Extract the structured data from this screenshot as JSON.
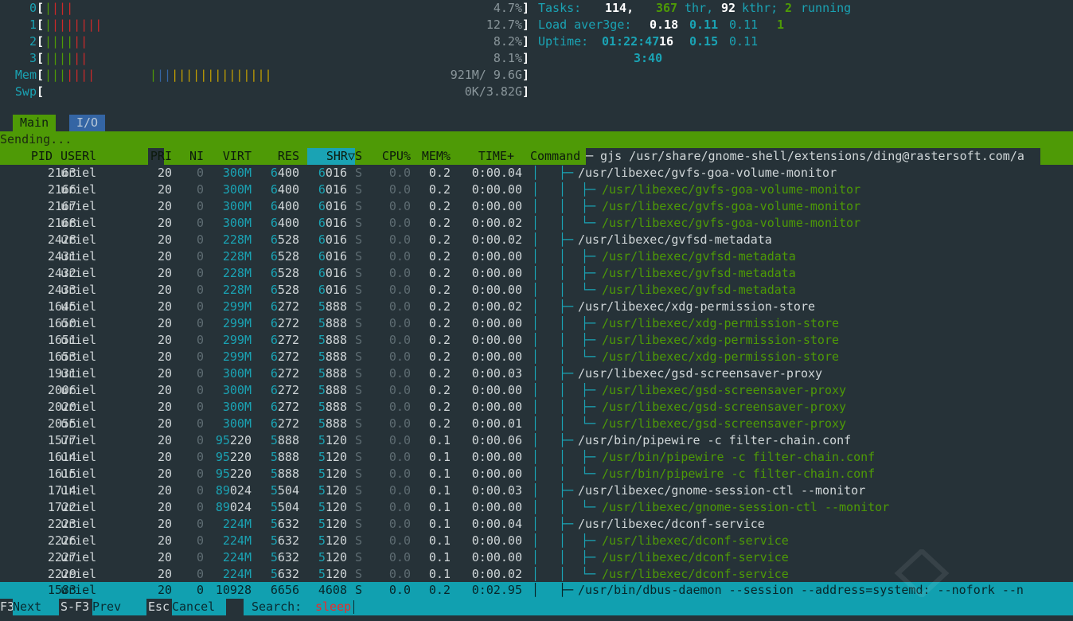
{
  "meters": {
    "cpus": [
      {
        "label": "0",
        "percent": "4.7%",
        "bars_green": 1,
        "bars_red": 3
      },
      {
        "label": "1",
        "percent": "12.7%",
        "bars_green": 1,
        "bars_red": 7
      },
      {
        "label": "2",
        "percent": "8.2%",
        "bars_green": 4,
        "bars_red": 2
      },
      {
        "label": "3",
        "percent": "8.1%",
        "bars_green": 4,
        "bars_red": 2
      }
    ],
    "mem": {
      "label": "Mem",
      "value": "921M/ 9.6G"
    },
    "swp": {
      "label": "Swp",
      "value": "0K/3.82G"
    }
  },
  "summary": {
    "tasks_label": "Tasks:",
    "tasks": "114,",
    "threads": "367",
    "thr_label": "thr,",
    "kthreads": "92",
    "kthr_label": "kthr;",
    "running": "2",
    "running_label": "running",
    "load_label": "Load aver3ge:",
    "load1": "0.18",
    "load5": "0.11",
    "load15": "0.11",
    "load_extra": "1",
    "uptime_label": "Uptime:",
    "uptime": "01:22:47",
    "uptime_bold": "16",
    "uptime_a": "0.15",
    "uptime_b": "0.11",
    "uptime_wrap": "3:40"
  },
  "tabs": {
    "main": "Main",
    "io": "I/O"
  },
  "status_text": "Sending...",
  "columns": {
    "pid": "PID",
    "user": "USERl",
    "pri": "PRI",
    "ni": "NI",
    "virt": "VIRT",
    "res": "RES",
    "shr": "SHR",
    "sort_arrow": "▽",
    "s": "S",
    "cpu": "CPU%",
    "mem": "MEM%",
    "time": "TIME+",
    "command": "Command"
  },
  "header_cmd": "─ gjs /usr/share/gnome-shell/extensions/ding@rastersoft.com/a",
  "processes": [
    {
      "pid": "2163",
      "user": "uriel",
      "pri": "20",
      "ni": "0",
      "virt": "300M",
      "res_a": "6",
      "res_b": "400",
      "shr_a": "6",
      "shr_b": "016",
      "s": "S",
      "cpu": "0.0",
      "mem": "0.2",
      "time": "0:00.04",
      "tree": "├─",
      "cmd": "/usr/libexec/gvfs-goa-volume-monitor",
      "child": false
    },
    {
      "pid": "2166",
      "user": "uriel",
      "pri": "20",
      "ni": "0",
      "virt": "300M",
      "res_a": "6",
      "res_b": "400",
      "shr_a": "6",
      "shr_b": "016",
      "s": "S",
      "cpu": "0.0",
      "mem": "0.2",
      "time": "0:00.00",
      "tree": "├─",
      "cmd": "/usr/libexec/gvfs-goa-volume-monitor",
      "child": true
    },
    {
      "pid": "2167",
      "user": "uriel",
      "pri": "20",
      "ni": "0",
      "virt": "300M",
      "res_a": "6",
      "res_b": "400",
      "shr_a": "6",
      "shr_b": "016",
      "s": "S",
      "cpu": "0.0",
      "mem": "0.2",
      "time": "0:00.00",
      "tree": "├─",
      "cmd": "/usr/libexec/gvfs-goa-volume-monitor",
      "child": true
    },
    {
      "pid": "2168",
      "user": "uriel",
      "pri": "20",
      "ni": "0",
      "virt": "300M",
      "res_a": "6",
      "res_b": "400",
      "shr_a": "6",
      "shr_b": "016",
      "s": "S",
      "cpu": "0.0",
      "mem": "0.2",
      "time": "0:00.02",
      "tree": "└─",
      "cmd": "/usr/libexec/gvfs-goa-volume-monitor",
      "child": true
    },
    {
      "pid": "2428",
      "user": "uriel",
      "pri": "20",
      "ni": "0",
      "virt": "228M",
      "res_a": "6",
      "res_b": "528",
      "shr_a": "6",
      "shr_b": "016",
      "s": "S",
      "cpu": "0.0",
      "mem": "0.2",
      "time": "0:00.02",
      "tree": "├─",
      "cmd": "/usr/libexec/gvfsd-metadata",
      "child": false
    },
    {
      "pid": "2431",
      "user": "uriel",
      "pri": "20",
      "ni": "0",
      "virt": "228M",
      "res_a": "6",
      "res_b": "528",
      "shr_a": "6",
      "shr_b": "016",
      "s": "S",
      "cpu": "0.0",
      "mem": "0.2",
      "time": "0:00.00",
      "tree": "├─",
      "cmd": "/usr/libexec/gvfsd-metadata",
      "child": true
    },
    {
      "pid": "2432",
      "user": "uriel",
      "pri": "20",
      "ni": "0",
      "virt": "228M",
      "res_a": "6",
      "res_b": "528",
      "shr_a": "6",
      "shr_b": "016",
      "s": "S",
      "cpu": "0.0",
      "mem": "0.2",
      "time": "0:00.00",
      "tree": "├─",
      "cmd": "/usr/libexec/gvfsd-metadata",
      "child": true
    },
    {
      "pid": "2433",
      "user": "uriel",
      "pri": "20",
      "ni": "0",
      "virt": "228M",
      "res_a": "6",
      "res_b": "528",
      "shr_a": "6",
      "shr_b": "016",
      "s": "S",
      "cpu": "0.0",
      "mem": "0.2",
      "time": "0:00.00",
      "tree": "└─",
      "cmd": "/usr/libexec/gvfsd-metadata",
      "child": true
    },
    {
      "pid": "1645",
      "user": "uriel",
      "pri": "20",
      "ni": "0",
      "virt": "299M",
      "res_a": "6",
      "res_b": "272",
      "shr_a": "5",
      "shr_b": "888",
      "s": "S",
      "cpu": "0.0",
      "mem": "0.2",
      "time": "0:00.02",
      "tree": "├─",
      "cmd": "/usr/libexec/xdg-permission-store",
      "child": false
    },
    {
      "pid": "1650",
      "user": "uriel",
      "pri": "20",
      "ni": "0",
      "virt": "299M",
      "res_a": "6",
      "res_b": "272",
      "shr_a": "5",
      "shr_b": "888",
      "s": "S",
      "cpu": "0.0",
      "mem": "0.2",
      "time": "0:00.00",
      "tree": "├─",
      "cmd": "/usr/libexec/xdg-permission-store",
      "child": true
    },
    {
      "pid": "1651",
      "user": "uriel",
      "pri": "20",
      "ni": "0",
      "virt": "299M",
      "res_a": "6",
      "res_b": "272",
      "shr_a": "5",
      "shr_b": "888",
      "s": "S",
      "cpu": "0.0",
      "mem": "0.2",
      "time": "0:00.00",
      "tree": "├─",
      "cmd": "/usr/libexec/xdg-permission-store",
      "child": true
    },
    {
      "pid": "1653",
      "user": "uriel",
      "pri": "20",
      "ni": "0",
      "virt": "299M",
      "res_a": "6",
      "res_b": "272",
      "shr_a": "5",
      "shr_b": "888",
      "s": "S",
      "cpu": "0.0",
      "mem": "0.2",
      "time": "0:00.00",
      "tree": "└─",
      "cmd": "/usr/libexec/xdg-permission-store",
      "child": true
    },
    {
      "pid": "1931",
      "user": "uriel",
      "pri": "20",
      "ni": "0",
      "virt": "300M",
      "res_a": "6",
      "res_b": "272",
      "shr_a": "5",
      "shr_b": "888",
      "s": "S",
      "cpu": "0.0",
      "mem": "0.2",
      "time": "0:00.03",
      "tree": "├─",
      "cmd": "/usr/libexec/gsd-screensaver-proxy",
      "child": false
    },
    {
      "pid": "2006",
      "user": "uriel",
      "pri": "20",
      "ni": "0",
      "virt": "300M",
      "res_a": "6",
      "res_b": "272",
      "shr_a": "5",
      "shr_b": "888",
      "s": "S",
      "cpu": "0.0",
      "mem": "0.2",
      "time": "0:00.00",
      "tree": "├─",
      "cmd": "/usr/libexec/gsd-screensaver-proxy",
      "child": true
    },
    {
      "pid": "2020",
      "user": "uriel",
      "pri": "20",
      "ni": "0",
      "virt": "300M",
      "res_a": "6",
      "res_b": "272",
      "shr_a": "5",
      "shr_b": "888",
      "s": "S",
      "cpu": "0.0",
      "mem": "0.2",
      "time": "0:00.00",
      "tree": "├─",
      "cmd": "/usr/libexec/gsd-screensaver-proxy",
      "child": true
    },
    {
      "pid": "2055",
      "user": "uriel",
      "pri": "20",
      "ni": "0",
      "virt": "300M",
      "res_a": "6",
      "res_b": "272",
      "shr_a": "5",
      "shr_b": "888",
      "s": "S",
      "cpu": "0.0",
      "mem": "0.2",
      "time": "0:00.01",
      "tree": "└─",
      "cmd": "/usr/libexec/gsd-screensaver-proxy",
      "child": true
    },
    {
      "pid": "1577",
      "user": "uriel",
      "pri": "20",
      "ni": "0",
      "virt_a": "95",
      "virt": "220",
      "res_a": "5",
      "res_b": "888",
      "shr_a": "5",
      "shr_b": "120",
      "s": "S",
      "cpu": "0.0",
      "mem": "0.1",
      "time": "0:00.06",
      "tree": "├─",
      "cmd": "/usr/bin/pipewire -c filter-chain.conf",
      "child": false
    },
    {
      "pid": "1614",
      "user": "uriel",
      "pri": "20",
      "ni": "0",
      "virt_a": "95",
      "virt": "220",
      "res_a": "5",
      "res_b": "888",
      "shr_a": "5",
      "shr_b": "120",
      "s": "S",
      "cpu": "0.0",
      "mem": "0.1",
      "time": "0:00.00",
      "tree": "├─",
      "cmd": "/usr/bin/pipewire -c filter-chain.conf",
      "child": true
    },
    {
      "pid": "1615",
      "user": "uriel",
      "pri": "20",
      "ni": "0",
      "virt_a": "95",
      "virt": "220",
      "res_a": "5",
      "res_b": "888",
      "shr_a": "5",
      "shr_b": "120",
      "s": "S",
      "cpu": "0.0",
      "mem": "0.1",
      "time": "0:00.00",
      "tree": "└─",
      "cmd": "/usr/bin/pipewire -c filter-chain.conf",
      "child": true
    },
    {
      "pid": "1714",
      "user": "uriel",
      "pri": "20",
      "ni": "0",
      "virt_a": "89",
      "virt": "024",
      "res_a": "5",
      "res_b": "504",
      "shr_a": "5",
      "shr_b": "120",
      "s": "S",
      "cpu": "0.0",
      "mem": "0.1",
      "time": "0:00.03",
      "tree": "├─",
      "cmd": "/usr/libexec/gnome-session-ctl --monitor",
      "child": false
    },
    {
      "pid": "1722",
      "user": "uriel",
      "pri": "20",
      "ni": "0",
      "virt_a": "89",
      "virt": "024",
      "res_a": "5",
      "res_b": "504",
      "shr_a": "5",
      "shr_b": "120",
      "s": "S",
      "cpu": "0.0",
      "mem": "0.1",
      "time": "0:00.00",
      "tree": "└─",
      "cmd": "/usr/libexec/gnome-session-ctl --monitor",
      "child": true
    },
    {
      "pid": "2223",
      "user": "uriel",
      "pri": "20",
      "ni": "0",
      "virt": "224M",
      "res_a": "5",
      "res_b": "632",
      "shr_a": "5",
      "shr_b": "120",
      "s": "S",
      "cpu": "0.0",
      "mem": "0.1",
      "time": "0:00.04",
      "tree": "├─",
      "cmd": "/usr/libexec/dconf-service",
      "child": false
    },
    {
      "pid": "2226",
      "user": "uriel",
      "pri": "20",
      "ni": "0",
      "virt": "224M",
      "res_a": "5",
      "res_b": "632",
      "shr_a": "5",
      "shr_b": "120",
      "s": "S",
      "cpu": "0.0",
      "mem": "0.1",
      "time": "0:00.00",
      "tree": "├─",
      "cmd": "/usr/libexec/dconf-service",
      "child": true
    },
    {
      "pid": "2227",
      "user": "uriel",
      "pri": "20",
      "ni": "0",
      "virt": "224M",
      "res_a": "5",
      "res_b": "632",
      "shr_a": "5",
      "shr_b": "120",
      "s": "S",
      "cpu": "0.0",
      "mem": "0.1",
      "time": "0:00.00",
      "tree": "├─",
      "cmd": "/usr/libexec/dconf-service",
      "child": true
    },
    {
      "pid": "2229",
      "user": "uriel",
      "pri": "20",
      "ni": "0",
      "virt": "224M",
      "res_a": "5",
      "res_b": "632",
      "shr_a": "5",
      "shr_b": "120",
      "s": "S",
      "cpu": "0.0",
      "mem": "0.1",
      "time": "0:00.02",
      "tree": "└─",
      "cmd": "/usr/libexec/dconf-service",
      "child": true
    }
  ],
  "selected": {
    "pid": "1583",
    "user": "uriel",
    "pri": "20",
    "ni": "0",
    "virt": "10928",
    "res": "6656",
    "shr": "4608",
    "s": "S",
    "cpu": "0.0",
    "mem": "0.2",
    "time": "0:02.95",
    "tree": "├─",
    "cmd": "/usr/bin/dbus-daemon --session --address=systemd: --nofork --n"
  },
  "footer": {
    "f3_key": "F3",
    "f3_label": "Next",
    "sf3_key": "S-F3",
    "sf3_label": "Prev",
    "esc_key": "Esc",
    "esc_label": "Cancel",
    "search_label": "Search: ",
    "search_value": "sleep"
  },
  "colors": {
    "accent": "#1aa3b4",
    "header_bg": "#4e9a06",
    "background": "#263238"
  }
}
